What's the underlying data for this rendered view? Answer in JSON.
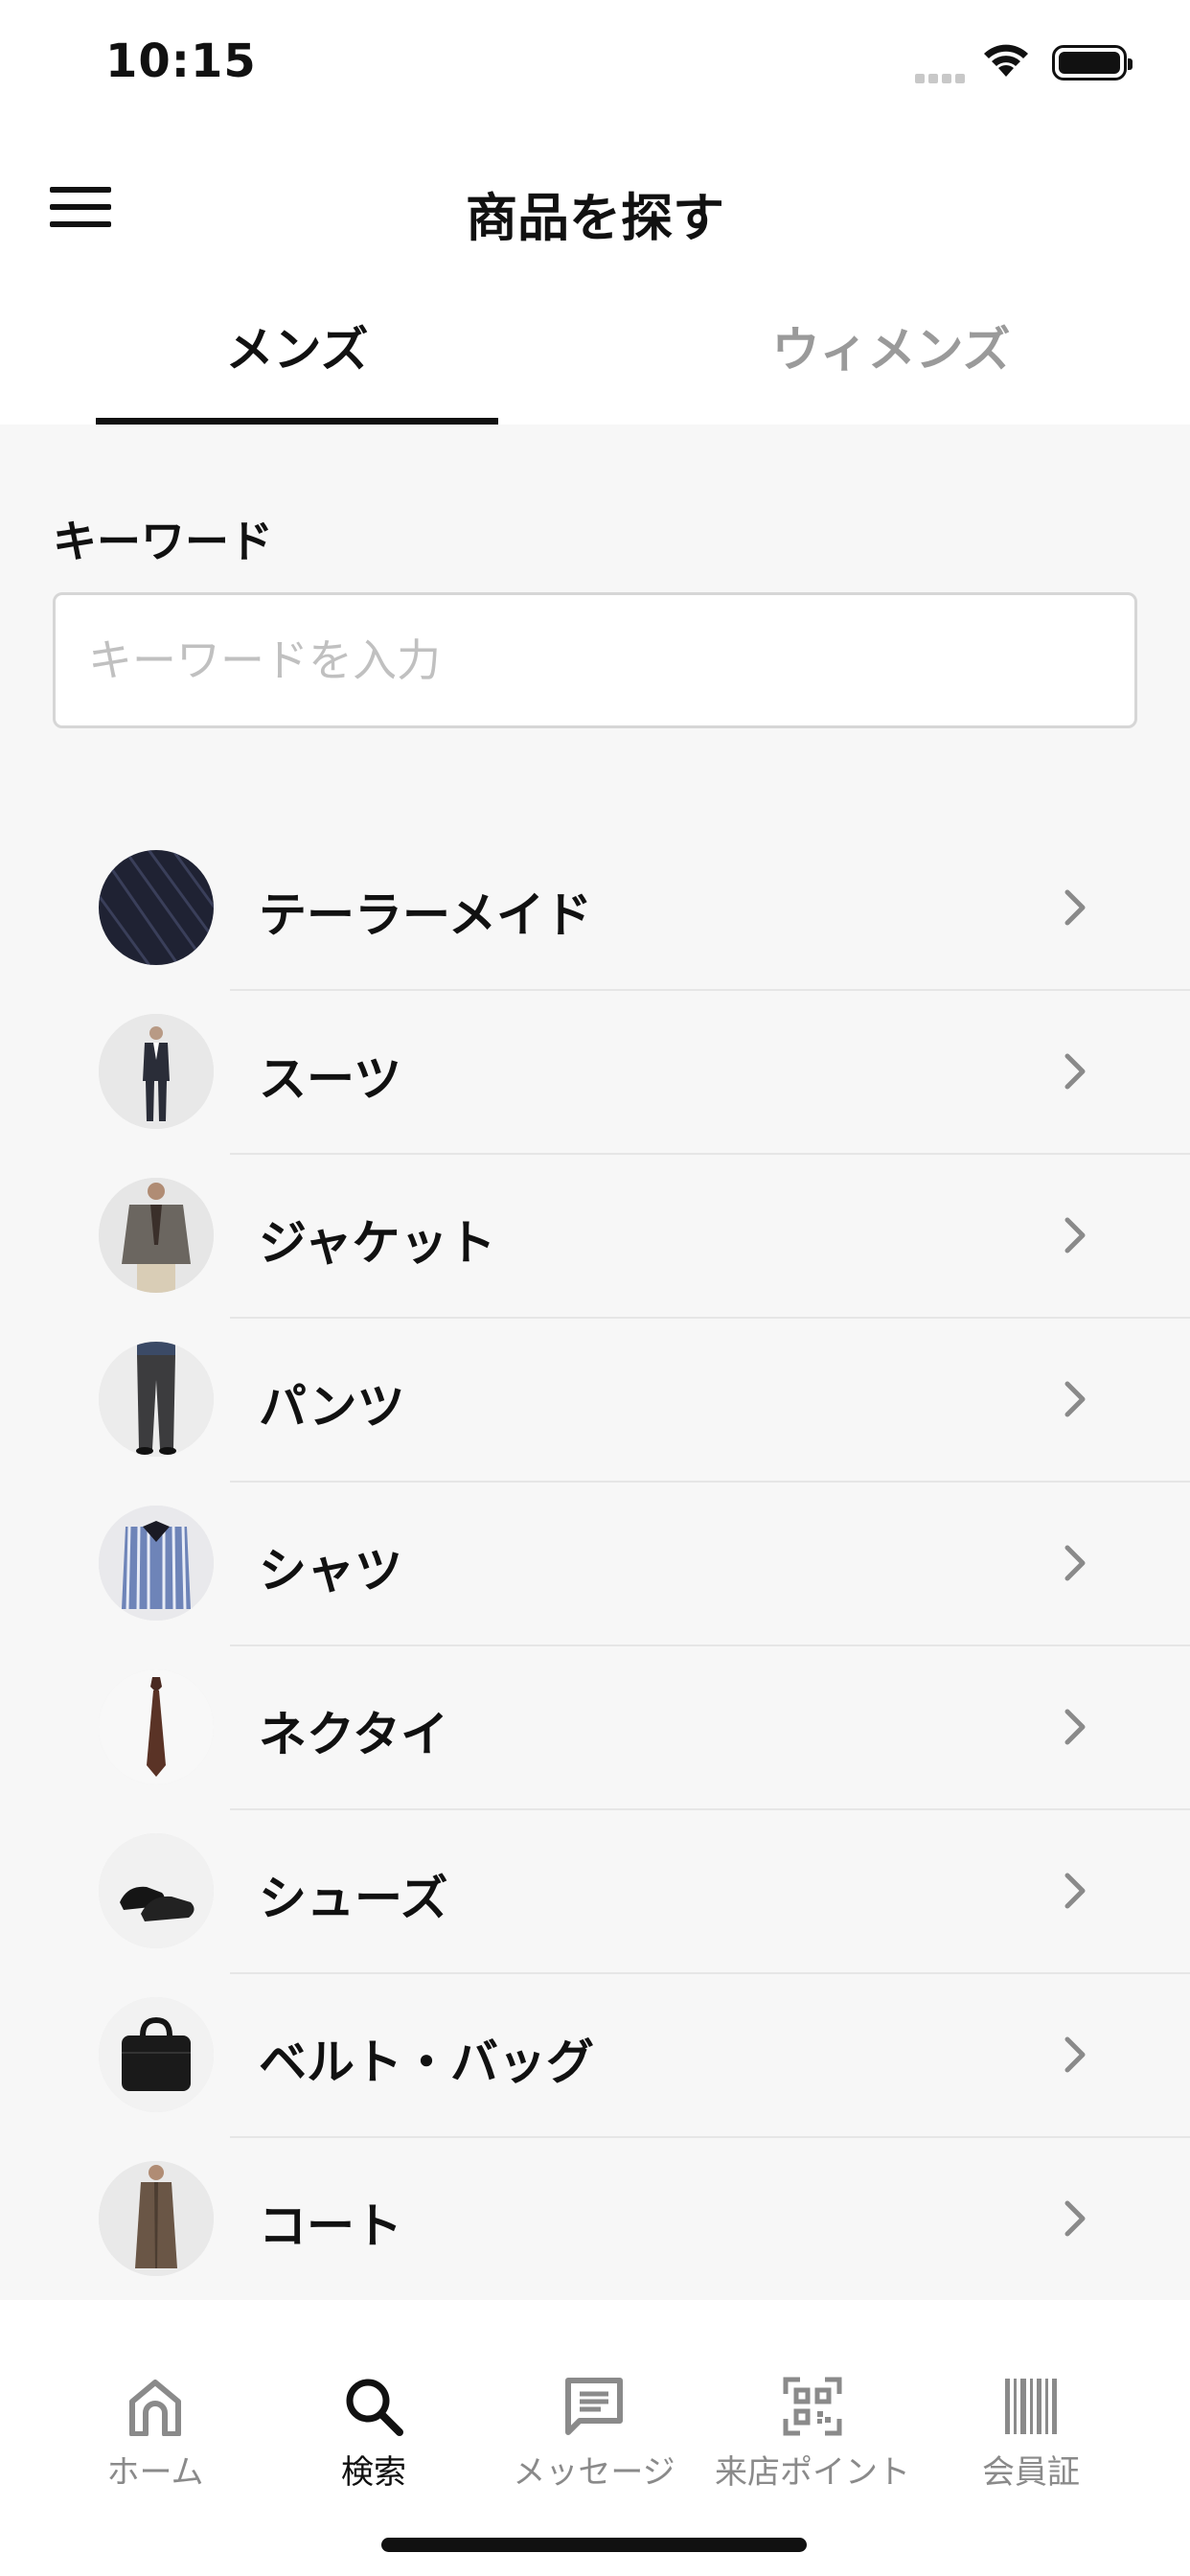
{
  "status_bar": {
    "time": "10:15"
  },
  "header": {
    "title": "商品を探す"
  },
  "tabs": [
    {
      "label": "メンズ",
      "active": true
    },
    {
      "label": "ウィメンズ",
      "active": false
    }
  ],
  "search": {
    "label": "キーワード",
    "placeholder": "キーワードを入力"
  },
  "categories": [
    {
      "label": "テーラーメイド",
      "thumb_icon": "fabric-swatch"
    },
    {
      "label": "スーツ",
      "thumb_icon": "suit-photo"
    },
    {
      "label": "ジャケット",
      "thumb_icon": "jacket-photo"
    },
    {
      "label": "パンツ",
      "thumb_icon": "pants-photo"
    },
    {
      "label": "シャツ",
      "thumb_icon": "shirt-photo"
    },
    {
      "label": "ネクタイ",
      "thumb_icon": "necktie-photo"
    },
    {
      "label": "シューズ",
      "thumb_icon": "shoes-photo"
    },
    {
      "label": "ベルト・バッグ",
      "thumb_icon": "bag-photo"
    },
    {
      "label": "コート",
      "thumb_icon": "coat-photo"
    }
  ],
  "tab_bar": [
    {
      "label": "ホーム",
      "icon": "home-icon",
      "active": false
    },
    {
      "label": "検索",
      "icon": "search-icon",
      "active": true
    },
    {
      "label": "メッセージ",
      "icon": "message-icon",
      "active": false
    },
    {
      "label": "来店ポイント",
      "icon": "qr-code-icon",
      "active": false
    },
    {
      "label": "会員証",
      "icon": "barcode-icon",
      "active": false
    }
  ],
  "colors": {
    "text": "#111111",
    "inactive": "#8a8a8a",
    "background": "#f7f7f7"
  }
}
